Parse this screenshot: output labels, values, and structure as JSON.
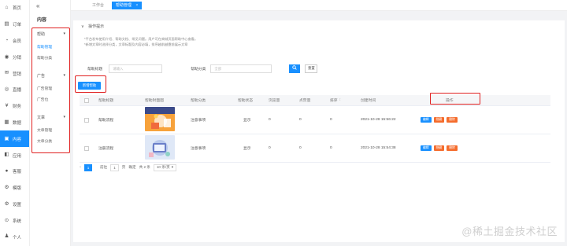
{
  "sidebar": {
    "items": [
      {
        "icon": "home-icon",
        "glyph": "⌂",
        "label": "首页"
      },
      {
        "icon": "order-icon",
        "glyph": "▤",
        "label": "订单"
      },
      {
        "icon": "member-icon",
        "glyph": "◔",
        "label": "会员"
      },
      {
        "icon": "distribution-icon",
        "glyph": "◉",
        "label": "分销"
      },
      {
        "icon": "marketing-icon",
        "glyph": "✉",
        "label": "营销"
      },
      {
        "icon": "live-icon",
        "glyph": "◎",
        "label": "直播"
      },
      {
        "icon": "finance-icon",
        "glyph": "¥",
        "label": "财务"
      },
      {
        "icon": "data-icon",
        "glyph": "▦",
        "label": "数据"
      },
      {
        "icon": "content-icon",
        "glyph": "▣",
        "label": "内容",
        "active": true
      },
      {
        "icon": "apps-icon",
        "glyph": "◧",
        "label": "应用"
      },
      {
        "icon": "service-icon",
        "glyph": "●",
        "label": "客服"
      },
      {
        "icon": "template-icon",
        "glyph": "⚙",
        "label": "模版"
      },
      {
        "icon": "settings-icon",
        "glyph": "⚙",
        "label": "设置"
      },
      {
        "icon": "system-icon",
        "glyph": "⊙",
        "label": "系统"
      },
      {
        "icon": "user-icon",
        "glyph": "♟",
        "label": "个人"
      }
    ]
  },
  "submenu": {
    "collapse_glyph": "«",
    "title": "内容",
    "groups": [
      {
        "label": "帮助",
        "arrow": "▾",
        "items": [
          {
            "label": "帮助管理",
            "active": true
          },
          {
            "label": "帮助分类"
          }
        ]
      },
      {
        "label": "广告",
        "arrow": "▾",
        "items": [
          {
            "label": "广告管理"
          },
          {
            "label": "广告位"
          }
        ]
      },
      {
        "label": "文章",
        "arrow": "▾",
        "items": [
          {
            "label": "文章管理"
          },
          {
            "label": "文章分类"
          }
        ]
      }
    ]
  },
  "tabs": [
    {
      "label": "工作台"
    },
    {
      "label": "帮助管理",
      "active": true,
      "close": "×"
    }
  ],
  "tip": {
    "toggle": "∨",
    "heading": "操作提示",
    "lines": [
      "*平台发布使用介绍、帮助文档、常见问题。用户可在商城页面帮助中心查看。",
      "*新增文章时选择分类，文章标题及内容必填，排序越前越靠前展示文章"
    ]
  },
  "search": {
    "title_label": "帮助标题",
    "title_placeholder": "请输入",
    "category_label": "帮助分类",
    "category_placeholder": "全部",
    "search_glyph": "🔍",
    "reset_label": "重置"
  },
  "add_button": "新增帮助",
  "table": {
    "headers": [
      "帮助标题",
      "帮助封面图",
      "帮助分类",
      "帮助状态",
      "浏览量",
      "点赞量",
      "排序",
      "创建时间",
      "操作"
    ],
    "sort_glyph": "↕",
    "rows": [
      {
        "title": "帮助流程",
        "category": "注意事项",
        "status": "显示",
        "views": "0",
        "likes": "0",
        "sort": "0",
        "created": "2021-10-28 15:56:22",
        "thumb": "orange"
      },
      {
        "title": "注册流程",
        "category": "注意事项",
        "status": "显示",
        "views": "0",
        "likes": "0",
        "sort": "0",
        "created": "2021-10-28 15:54:38",
        "thumb": "lavender"
      }
    ],
    "actions": [
      {
        "label": "编辑",
        "color": "#1890ff"
      },
      {
        "label": "隐藏",
        "color": "#f56c2c"
      },
      {
        "label": "删除",
        "color": "#f56c2c"
      }
    ]
  },
  "pager": {
    "prev": "‹",
    "current": "1",
    "jump_label": "前往",
    "jump_value": "1",
    "page_unit": "页",
    "confirm": "确定",
    "total": "共 2 条",
    "size": "10 条/页",
    "size_arrow": "▾"
  },
  "watermark": "@稀土掘金技术社区",
  "colors": {
    "accent": "#1890ff",
    "danger": "#f56c2c",
    "highlight_box": "#e02020"
  }
}
